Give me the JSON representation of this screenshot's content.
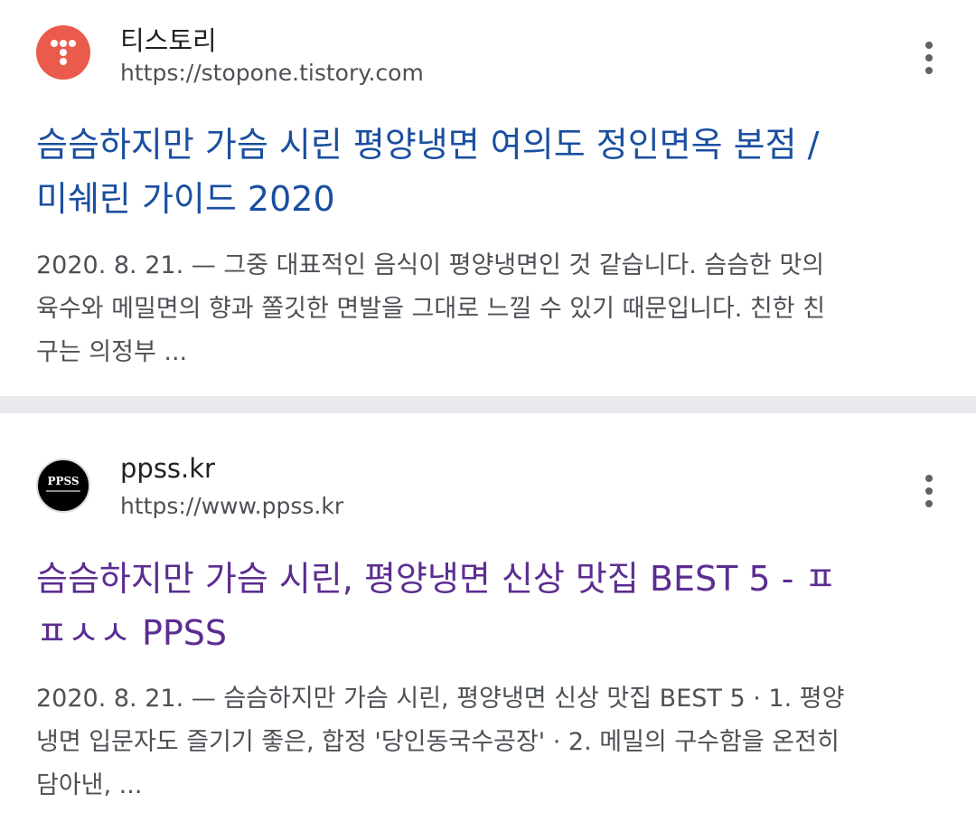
{
  "results": [
    {
      "site_name": "티스토리",
      "url": "https://stopone.tistory.com",
      "favicon": "tistory-logo",
      "title_lines": [
        "슴슴하지만 가슴 시린 평양냉면 여의도 정인면옥 본점 /",
        "미쉐린 가이드 2020"
      ],
      "snippet_lines": [
        "2020. 8. 21. — 그중 대표적인 음식이 평양냉면인 것 같습니다. 슴슴한 맛의",
        "육수와 메밀면의 향과 쫄깃한 면발을 그대로 느낄 수 있기 때문입니다. 친한 친",
        "구는 의정부 ..."
      ],
      "title_color": "#1a4fa0"
    },
    {
      "site_name": "ppss.kr",
      "url": "https://www.ppss.kr",
      "favicon": "ppss-logo",
      "favicon_text": "PPSS",
      "title_lines": [
        "슴슴하지만 가슴 시린, 평양냉면 신상 맛집 BEST 5 - ㅍ",
        "ㅍㅅㅅ PPSS"
      ],
      "snippet_lines": [
        "2020. 8. 21. — 슴슴하지만 가슴 시린, 평양냉면 신상 맛집 BEST 5 · 1. 평양",
        "냉면 입문자도 즐기기 좋은, 합정 '당인동국수공장' · 2. 메밀의 구수함을 온전히",
        "담아낸, ..."
      ],
      "title_color": "#5c2d91"
    }
  ],
  "colors": {
    "visited_link": "#5c2d91",
    "link": "#1a4fa0",
    "separator": "#e9eaee"
  }
}
